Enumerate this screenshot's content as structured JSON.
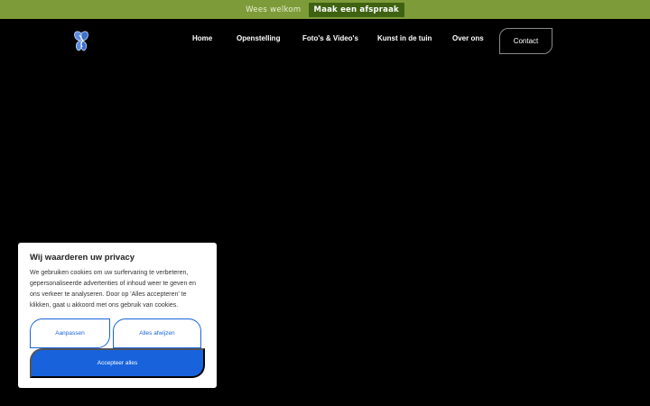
{
  "topbar": {
    "welcome": "Wees welkom",
    "cta": "Maak een afspraak",
    "background": "#7d9b38"
  },
  "header": {
    "logo_icon": "butterfly-logo-icon",
    "nav": [
      {
        "label": "Home"
      },
      {
        "label": "Openstelling"
      },
      {
        "label": "Foto's & Video's"
      },
      {
        "label": "Kunst in de tuin"
      },
      {
        "label": "Over ons"
      }
    ],
    "contact_label": "Contact"
  },
  "cookie": {
    "title": "Wij waarderen uw privacy",
    "text": "We gebruiken cookies om uw surfervaring te verbeteren, gepersonaliseerde advertenties of inhoud weer te geven en ons verkeer te analyseren. Door op 'Alles accepteren' te klikken, gaat u akkoord met ons gebruik van cookies.",
    "customize_label": "Aanpassen",
    "reject_label": "Alles afwijzen",
    "accept_label": "Accepteer alles",
    "accent": "#1863dc"
  }
}
